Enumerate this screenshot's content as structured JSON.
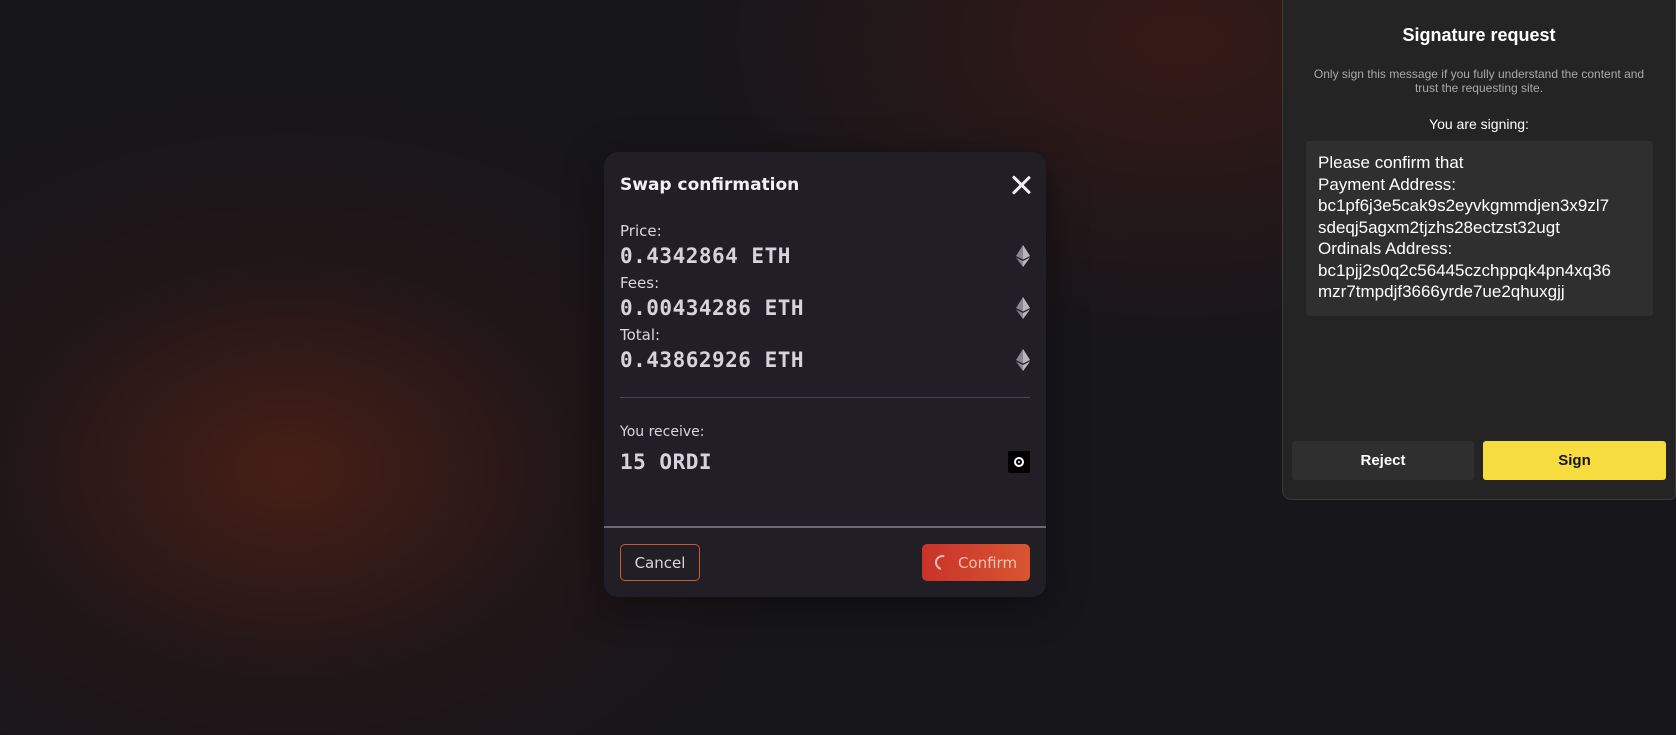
{
  "swap_modal": {
    "title": "Swap confirmation",
    "price": {
      "label": "Price:",
      "value": "0.4342864 ETH",
      "icon": "ethereum-icon"
    },
    "fees": {
      "label": "Fees:",
      "value": "0.00434286 ETH",
      "icon": "ethereum-icon"
    },
    "total": {
      "label": "Total:",
      "value": "0.43862926 ETH",
      "icon": "ethereum-icon"
    },
    "receive": {
      "label": "You receive:",
      "value": "15 ORDI",
      "icon": "ordi-token-icon"
    },
    "cancel_label": "Cancel",
    "confirm_label": "Confirm"
  },
  "signature_panel": {
    "title": "Signature request",
    "warning": "Only sign this message if you fully understand the content and trust the requesting site.",
    "signing_label": "You are signing:",
    "message_lines": [
      "Please confirm that",
      "Payment Address:",
      "bc1pf6j3e5cak9s2eyvkgmmdjen3x9zl7",
      "sdeqj5agxm2tjzhs28ectzst32ugt",
      "Ordinals Address:",
      "bc1pjj2s0q2c56445czchppqk4pn4xq36",
      "mzr7tmpdjf3666yrde7ue2qhuxgjj"
    ],
    "reject_label": "Reject",
    "sign_label": "Sign"
  },
  "colors": {
    "background": "#17161b",
    "modal_bg": "#211e26",
    "confirm_accent": "#c9322a",
    "sign_accent": "#f7dc3f"
  }
}
